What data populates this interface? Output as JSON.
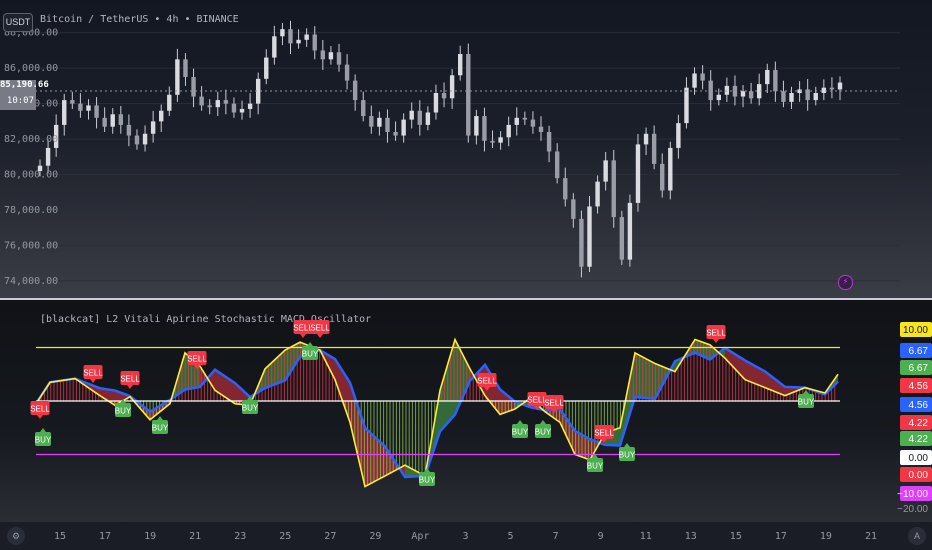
{
  "toolbar": {
    "currency": "USDT"
  },
  "symbol": {
    "title": "Bitcoin / TetherUS • 4h • BINANCE"
  },
  "price_axis": {
    "ticks": [
      "88,000.00",
      "86,000.00",
      "84,000.00",
      "82,000.00",
      "80,000.00",
      "78,000.00",
      "76,000.00",
      "74,000.00"
    ],
    "tick_values": [
      88000,
      86000,
      84000,
      82000,
      80000,
      78000,
      76000,
      74000
    ],
    "current_price": "85,190.66",
    "countdown": "10:07",
    "ylim": [
      73600,
      89000
    ]
  },
  "indicator": {
    "title": "[blackcat] L2 Vitali Apirine Stochastic MACD Oscillator",
    "axis_labels": [
      {
        "text": "10.00",
        "bg": "#f7e51d",
        "fg": "#131722"
      },
      {
        "text": "6.67",
        "bg": "#2962ff",
        "fg": "#ffffff"
      },
      {
        "text": "6.67",
        "bg": "#4caf50",
        "fg": "#ffffff"
      },
      {
        "text": "4.56",
        "bg": "#f23645",
        "fg": "#ffffff"
      },
      {
        "text": "4.56",
        "bg": "#2962ff",
        "fg": "#ffffff"
      },
      {
        "text": "4.22",
        "bg": "#f23645",
        "fg": "#ffffff"
      },
      {
        "text": "4.22",
        "bg": "#4caf50",
        "fg": "#ffffff"
      },
      {
        "text": "0.00",
        "bg": "#ffffff",
        "fg": "#131722"
      },
      {
        "text": "0.00",
        "bg": "#f23645",
        "fg": "#ffffff"
      },
      {
        "text": "−10.00",
        "bg": "#e040fb",
        "fg": "#ffffff"
      },
      {
        "text": "−20.00",
        "bg": "",
        "fg": "#9598a1"
      }
    ],
    "upper_level": 10,
    "zero_level": 0,
    "lower_level": -10,
    "upper_color": "#f7e51d",
    "zero_color": "#ffffff",
    "lower_color": "#e040fb",
    "signals": [
      {
        "label": "SELL",
        "x": 303,
        "y": 327
      },
      {
        "label": "SELL",
        "x": 320,
        "y": 327
      },
      {
        "label": "SELL",
        "x": 716,
        "y": 332
      },
      {
        "label": "SELL",
        "x": 197,
        "y": 358
      },
      {
        "label": "SELL",
        "x": 93,
        "y": 372
      },
      {
        "label": "SELL",
        "x": 130,
        "y": 378
      },
      {
        "label": "SELL",
        "x": 487,
        "y": 380
      },
      {
        "label": "SELL",
        "x": 40,
        "y": 408
      },
      {
        "label": "SELL",
        "x": 537,
        "y": 399
      },
      {
        "label": "SELL",
        "x": 554,
        "y": 402
      },
      {
        "label": "SELL",
        "x": 604,
        "y": 432
      },
      {
        "label": "BUY",
        "x": 310,
        "y": 353
      },
      {
        "label": "BUY",
        "x": 123,
        "y": 410
      },
      {
        "label": "BUY",
        "x": 250,
        "y": 407
      },
      {
        "label": "BUY",
        "x": 806,
        "y": 401
      },
      {
        "label": "BUY",
        "x": 43,
        "y": 439
      },
      {
        "label": "BUY",
        "x": 160,
        "y": 427
      },
      {
        "label": "BUY",
        "x": 520,
        "y": 431
      },
      {
        "label": "BUY",
        "x": 543,
        "y": 431
      },
      {
        "label": "BUY",
        "x": 627,
        "y": 454
      },
      {
        "label": "BUY",
        "x": 595,
        "y": 465
      },
      {
        "label": "BUY",
        "x": 427,
        "y": 479
      }
    ]
  },
  "time_axis": {
    "labels": [
      "15",
      "17",
      "19",
      "21",
      "23",
      "25",
      "27",
      "29",
      "Apr",
      "3",
      "5",
      "7",
      "9",
      "11",
      "13",
      "15",
      "17",
      "19",
      "21"
    ]
  },
  "colors": {
    "sell": "#f23645",
    "buy": "#4caf50",
    "candle": "#d1d4dc"
  }
}
